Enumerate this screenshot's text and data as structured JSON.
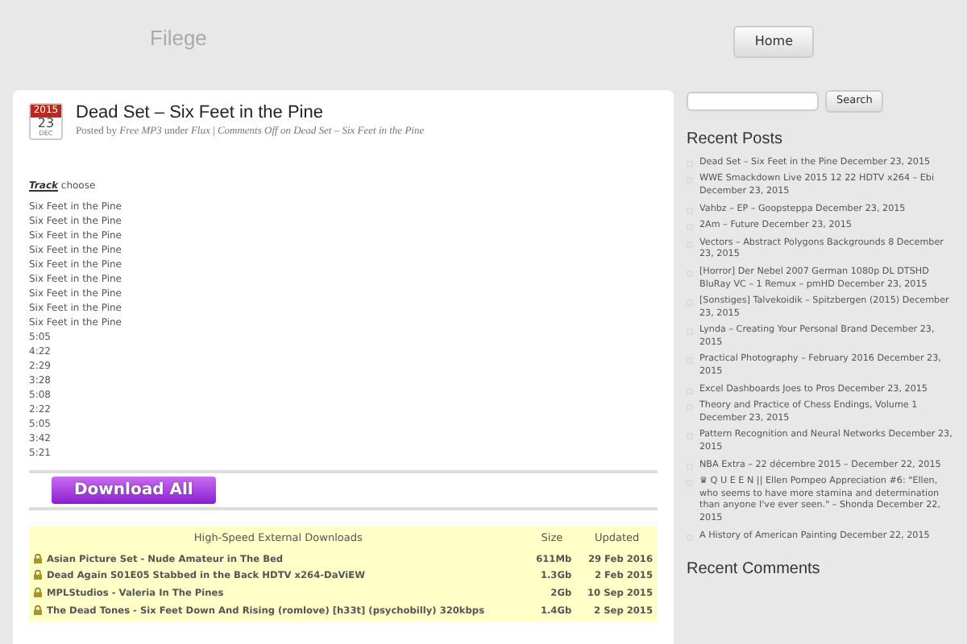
{
  "site_title": "Filege",
  "nav": [
    {
      "label": "Home"
    }
  ],
  "post": {
    "date": {
      "year": "2015",
      "day": "23",
      "month": "DEC"
    },
    "title": "Dead Set – Six Feet in the Pine",
    "meta": {
      "posted_by": "Posted by",
      "author": "Free MP3",
      "under": "under",
      "category": "Flux",
      "separator": "|",
      "comments": "Comments Off on Dead Set – Six Feet in the Pine"
    },
    "track_label": "Track",
    "track_note": "choose",
    "tracks": [
      "Six Feet in the Pine",
      "Six Feet in the Pine",
      "Six Feet in the Pine",
      "Six Feet in the Pine",
      "Six Feet in the Pine",
      "Six Feet in the Pine",
      "Six Feet in the Pine",
      "Six Feet in the Pine",
      "Six Feet in the Pine"
    ],
    "durations": [
      "5:05",
      "4:22",
      "2:29",
      "3:28",
      "5:08",
      "2:22",
      "5:05",
      "3:42",
      "5:21"
    ],
    "download_button": "Download All",
    "downloads": {
      "columns": [
        "High-Speed External Downloads",
        "Size",
        "Updated"
      ],
      "rows": [
        {
          "name": "Asian Picture Set - Nude Amateur in The Bed",
          "size": "611Mb",
          "updated": "29 Feb 2016"
        },
        {
          "name": "Dead Again S01E05 Stabbed in the Back HDTV x264-DaViEW",
          "size": "1.3Gb",
          "updated": "2 Feb 2015"
        },
        {
          "name": "MPLStudios - Valeria In The Pines",
          "size": "2Gb",
          "updated": "10 Sep 2015"
        },
        {
          "name": "The Dead Tones - Six Feet Down And Rising (romlove) [h33t] (psychobilly) 320kbps",
          "size": "1.4Gb",
          "updated": "2 Sep 2015"
        }
      ]
    }
  },
  "sidebar": {
    "search_button": "Search",
    "recent_posts_heading": "Recent Posts",
    "recent_posts": [
      "Dead Set – Six Feet in the Pine December 23, 2015",
      "WWE Smackdown Live 2015 12 22 HDTV x264 – Ebi December 23, 2015",
      "Vahbz – EP – Goopsteppa December 23, 2015",
      "2Am – Future December 23, 2015",
      "Vectors – Abstract Polygons Backgrounds 8 December 23, 2015",
      "[Horror] Der Nebel 2007 German 1080p DL DTSHD BluRay VC – 1 Remux – pmHD December 23, 2015",
      "[Sonstiges] Talvekoidik – Spitzbergen (2015) December 23, 2015",
      "Lynda – Creating Your Personal Brand December 23, 2015",
      "Practical Photography – February 2016 December 23, 2015",
      "Excel Dashboards Joes to Pros December 23, 2015",
      "Theory and Practice of Chess Endings, Volume 1 December 23, 2015",
      "Pattern Recognition and Neural Networks December 23, 2015",
      "NBA Extra – 22 décembre 2015 – December 22, 2015",
      "♛ Q U E E N || Ellen Pompeo Appreciation #6: \"Ellen, who seems to have more stamina and determination than anyone I've ever seen.\" – Shonda December 22, 2015",
      "A History of American Painting December 22, 2015"
    ],
    "recent_comments_heading": "Recent Comments"
  }
}
